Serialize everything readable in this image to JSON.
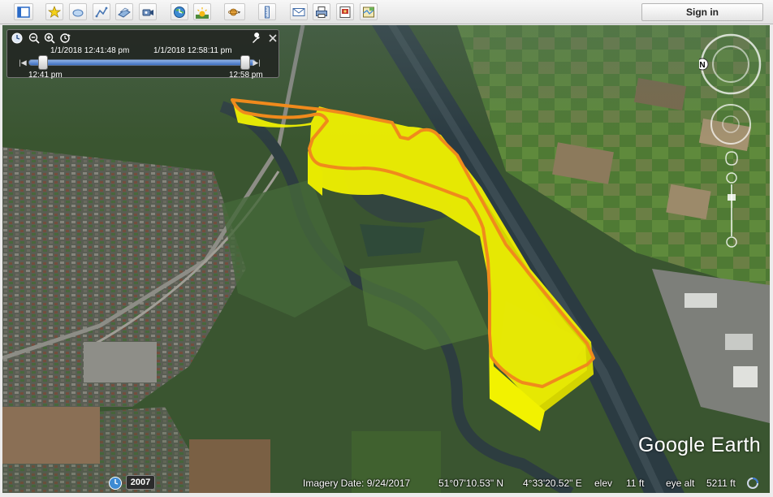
{
  "toolbar": {
    "buttons": [
      {
        "name": "sidebar-toggle-button",
        "icon": "sidebar-icon"
      },
      {
        "name": "add-placemark-button",
        "icon": "placemark-pin-icon"
      },
      {
        "name": "add-polygon-button",
        "icon": "polygon-icon"
      },
      {
        "name": "add-path-button",
        "icon": "path-icon"
      },
      {
        "name": "add-image-overlay-button",
        "icon": "image-overlay-icon"
      },
      {
        "name": "record-tour-button",
        "icon": "record-tour-icon"
      },
      {
        "name": "historical-imagery-button",
        "icon": "clock-globe-icon"
      },
      {
        "name": "sunlight-button",
        "icon": "sun-icon"
      },
      {
        "name": "switch-planet-button",
        "icon": "planet-icon"
      },
      {
        "name": "ruler-button",
        "icon": "ruler-icon"
      },
      {
        "name": "email-button",
        "icon": "envelope-icon"
      },
      {
        "name": "print-button",
        "icon": "printer-icon"
      },
      {
        "name": "save-image-button",
        "icon": "save-image-icon"
      },
      {
        "name": "view-in-maps-button",
        "icon": "map-icon"
      }
    ],
    "sign_in": "Sign in"
  },
  "time_slider": {
    "range_start": "1/1/2018  12:41:48 pm",
    "range_end": "1/1/2018  12:58:11 pm",
    "start_time": "12:41 pm",
    "end_time": "12:58 pm",
    "selection_start_fraction": 0.0,
    "selection_end_fraction": 1.0
  },
  "status_bar": {
    "year": "2007",
    "imagery_date": "Imagery Date: 9/24/2017",
    "latitude": "51°07'10.53\" N",
    "longitude": "4°33'20.52\" E",
    "elev_label": "elev",
    "elev_value": "11 ft",
    "eye_alt_label": "eye alt",
    "eye_alt_value": "5211 ft"
  },
  "logo": "Google Earth",
  "compass_letter": "N",
  "colors": {
    "track_wall": "#f5f500",
    "track_line": "#f08a1c",
    "signin_text": "#222222"
  }
}
